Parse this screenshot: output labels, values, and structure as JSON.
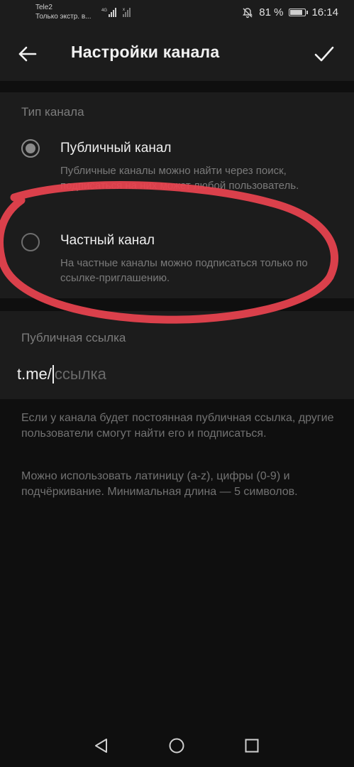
{
  "status_bar": {
    "carrier": "Tele2",
    "carrier_status": "Только экстр. в...",
    "network": "4G",
    "battery": "81 %",
    "battery_level": 0.81,
    "time": "16:14"
  },
  "header": {
    "title": "Настройки канала"
  },
  "channel_type": {
    "header": "Тип канала",
    "options": [
      {
        "title": "Публичный канал",
        "desc": "Публичные каналы можно найти через поиск, подписаться на них может любой пользователь.",
        "checked": true
      },
      {
        "title": "Частный канал",
        "desc": "На частные каналы можно подписаться только по ссылке-приглашению.",
        "checked": false
      }
    ]
  },
  "public_link": {
    "header": "Публичная ссылка",
    "prefix": "t.me/",
    "placeholder": "ссылка",
    "value": ""
  },
  "info": {
    "paragraph1": "Если у канала будет постоянная публичная ссылка, другие пользователи смогут найти его и подписаться.",
    "paragraph2": "Можно использовать латиницу (a-z), цифры (0-9) и подчёркивание. Минимальная длина — 5 символов."
  },
  "colors": {
    "annotation": "#e8434f",
    "background": "#0f0f0f",
    "surface": "#1c1c1c"
  }
}
